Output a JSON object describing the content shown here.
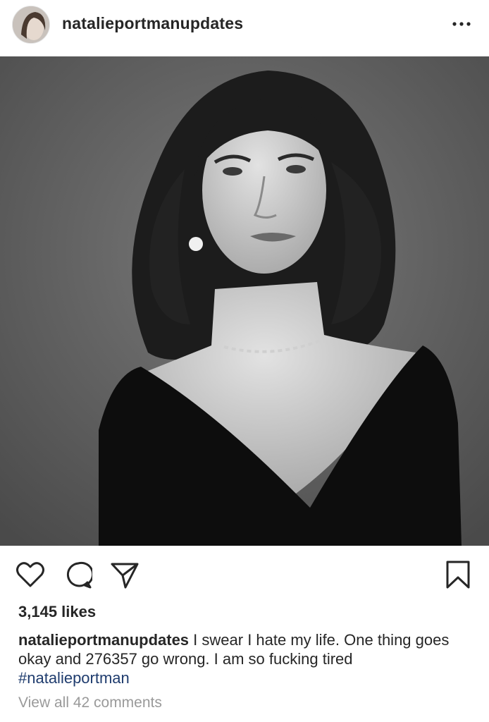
{
  "post": {
    "username": "natalieportmanupdates",
    "likes": "3,145 likes",
    "caption": {
      "username": "natalieportmanupdates",
      "text": "I swear I hate my life. One thing goes okay and 276357 go wrong. I am so fucking tired",
      "hashtag": "#natalieportman"
    },
    "view_comments": "View all 42 comments"
  },
  "icons": {
    "more": "more-options-icon",
    "like": "heart-icon",
    "comment": "comment-icon",
    "share": "paper-plane-icon",
    "save": "bookmark-icon"
  },
  "colors": {
    "text": "#262626",
    "hashtag": "#1f3c6e",
    "muted": "#9a9a9a",
    "photo_background": "#5e5e5e"
  }
}
